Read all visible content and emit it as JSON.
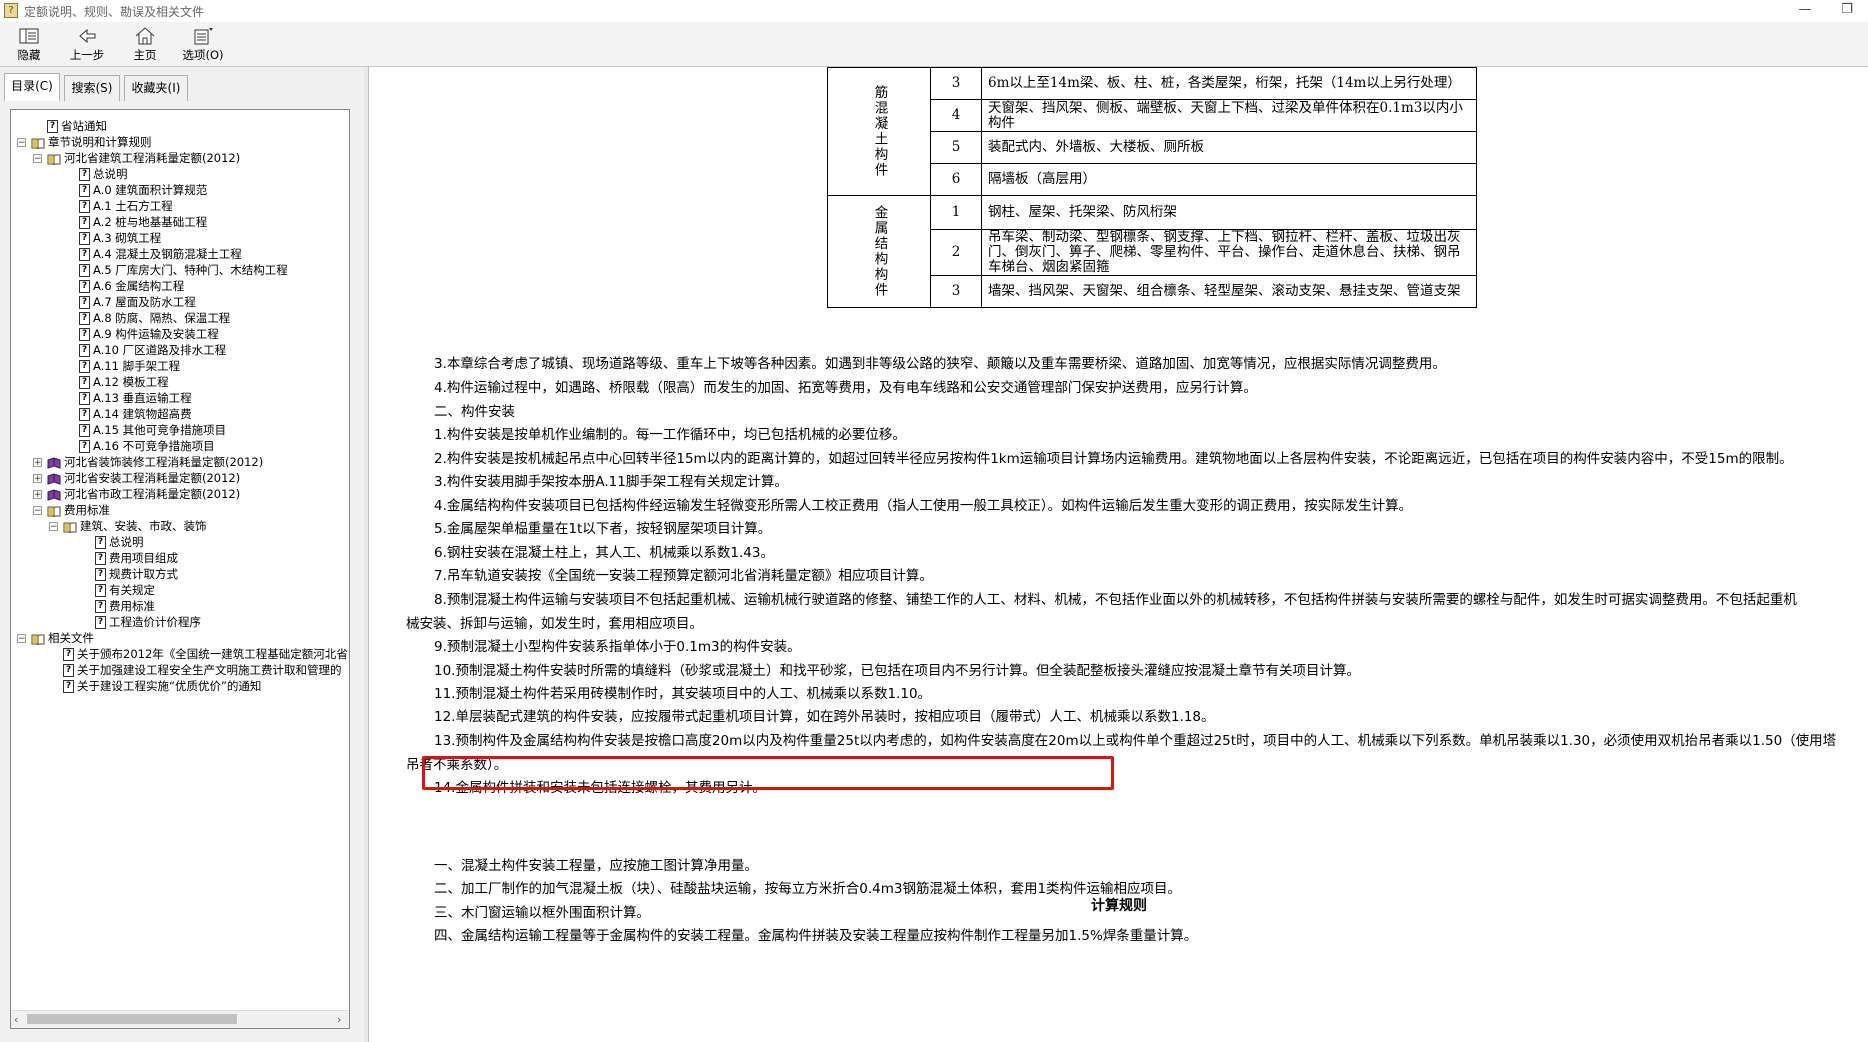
{
  "window": {
    "title": "定额说明、规则、勘误及相关文件",
    "min_glyph": "—",
    "max_glyph": "❐"
  },
  "toolbar": {
    "hide": "隐藏",
    "back": "上一步",
    "home": "主页",
    "options": "选项(O)"
  },
  "left_tabs": [
    "目录(C)",
    "搜索(S)",
    "收藏夹(I)"
  ],
  "tree": [
    {
      "label": "省站通知",
      "icon": "doc",
      "level": 1
    },
    {
      "label": "章节说明和计算规则",
      "icon": "book",
      "level": 0,
      "exp": "−"
    },
    {
      "label": "河北省建筑工程消耗量定额(2012)",
      "icon": "book",
      "level": 1,
      "exp": "−"
    },
    {
      "label": "总说明",
      "icon": "doc",
      "level": 3
    },
    {
      "label": "A.0 建筑面积计算规范",
      "icon": "doc",
      "level": 3
    },
    {
      "label": "A.1 土石方工程",
      "icon": "doc",
      "level": 3
    },
    {
      "label": "A.2 桩与地基基础工程",
      "icon": "doc",
      "level": 3
    },
    {
      "label": "A.3 砌筑工程",
      "icon": "doc",
      "level": 3
    },
    {
      "label": "A.4 混凝土及钢筋混凝土工程",
      "icon": "doc",
      "level": 3
    },
    {
      "label": "A.5 厂库房大门、特种门、木结构工程",
      "icon": "doc",
      "level": 3
    },
    {
      "label": "A.6 金属结构工程",
      "icon": "doc",
      "level": 3
    },
    {
      "label": "A.7 屋面及防水工程",
      "icon": "doc",
      "level": 3
    },
    {
      "label": "A.8 防腐、隔热、保温工程",
      "icon": "doc",
      "level": 3
    },
    {
      "label": "A.9 构件运输及安装工程",
      "icon": "doc",
      "level": 3
    },
    {
      "label": "A.10 厂区道路及排水工程",
      "icon": "doc",
      "level": 3
    },
    {
      "label": "A.11 脚手架工程",
      "icon": "doc",
      "level": 3
    },
    {
      "label": "A.12 模板工程",
      "icon": "doc",
      "level": 3
    },
    {
      "label": "A.13 垂直运输工程",
      "icon": "doc",
      "level": 3
    },
    {
      "label": "A.14 建筑物超高费",
      "icon": "doc",
      "level": 3
    },
    {
      "label": "A.15 其他可竞争措施项目",
      "icon": "doc",
      "level": 3
    },
    {
      "label": "A.16 不可竞争措施项目",
      "icon": "doc",
      "level": 3
    },
    {
      "label": "河北省装饰装修工程消耗量定额(2012)",
      "icon": "bookc",
      "level": 1,
      "exp": "+"
    },
    {
      "label": "河北省安装工程消耗量定额(2012)",
      "icon": "bookc",
      "level": 1,
      "exp": "+"
    },
    {
      "label": "河北省市政工程消耗量定额(2012)",
      "icon": "bookc",
      "level": 1,
      "exp": "+"
    },
    {
      "label": "费用标准",
      "icon": "book",
      "level": 1,
      "exp": "−"
    },
    {
      "label": "建筑、安装、市政、装饰",
      "icon": "book",
      "level": 2,
      "exp": "−"
    },
    {
      "label": "总说明",
      "icon": "doc",
      "level": 4
    },
    {
      "label": "费用项目组成",
      "icon": "doc",
      "level": 4
    },
    {
      "label": "规费计取方式",
      "icon": "doc",
      "level": 4
    },
    {
      "label": "有关规定",
      "icon": "doc",
      "level": 4
    },
    {
      "label": "费用标准",
      "icon": "doc",
      "level": 4
    },
    {
      "label": "工程造价计价程序",
      "icon": "doc",
      "level": 4
    },
    {
      "label": "相关文件",
      "icon": "book",
      "level": 0,
      "exp": "−"
    },
    {
      "label": "关于颁布2012年《全国统一建筑工程基础定额河北省",
      "icon": "doc",
      "level": 2
    },
    {
      "label": "关于加强建设工程安全生产文明施工费计取和管理的",
      "icon": "doc",
      "level": 2
    },
    {
      "label": "关于建设工程实施“优质优价”的通知",
      "icon": "doc",
      "level": 2
    }
  ],
  "table": {
    "groups": [
      {
        "category": "筋混凝土构件",
        "rows": [
          {
            "num": "3",
            "desc": "6m以上至14m梁、板、柱、桩，各类屋架，桁架，托架（14m以上另行处理）"
          },
          {
            "num": "4",
            "desc": "天窗架、挡风架、侧板、端壁板、天窗上下档、过梁及单件体积在0.1m3以内小构件"
          },
          {
            "num": "5",
            "desc": "装配式内、外墙板、大楼板、厕所板"
          },
          {
            "num": "6",
            "desc": "隔墙板（高层用）"
          }
        ]
      },
      {
        "category": "金属结构构件",
        "rows": [
          {
            "num": "1",
            "desc": "钢柱、屋架、托架梁、防风桁架"
          },
          {
            "num": "2",
            "desc": "吊车梁、制动梁、型钢檩条、钢支撑、上下档、钢拉杆、栏杆、盖板、垃圾出灰门、倒灰门、箅子、爬梯、零星构件、平台、操作台、走道休息台、扶梯、钢吊车梯台、烟囱紧固箍"
          },
          {
            "num": "3",
            "desc": "墙架、挡风架、天窗架、组合檩条、轻型屋架、滚动支架、悬挂支架、管道支架"
          }
        ]
      }
    ]
  },
  "paragraphs": [
    "3.本章综合考虑了城镇、现场道路等级、重车上下坡等各种因素。如遇到非等级公路的狭窄、颠簸以及重车需要桥梁、道路加固、加宽等情况，应根据实际情况调整费用。",
    "4.构件运输过程中，如遇路、桥限载（限高）而发生的加固、拓宽等费用，及有电车线路和公安交通管理部门保安护送费用，应另行计算。",
    "二、构件安装",
    "1.构件安装是按单机作业编制的。每一工作循环中，均已包括机械的必要位移。",
    "2.构件安装是按机械起吊点中心回转半径15m以内的距离计算的，如超过回转半径应另按构件1km运输项目计算场内运输费用。建筑物地面以上各层构件安装，不论距离远近，已包括在项目的构件安装内容中，不受15m的限制。",
    "3.构件安装用脚手架按本册A.11脚手架工程有关规定计算。",
    "4.金属结构构件安装项目已包括构件经运输发生轻微变形所需人工校正费用（指人工使用一般工具校正）。如构件运输后发生重大变形的调正费用，按实际发生计算。",
    "5.金属屋架单榀重量在1t以下者，按轻钢屋架项目计算。",
    "6.钢柱安装在混凝土柱上，其人工、机械乘以系数1.43。",
    "7.吊车轨道安装按《全国统一安装工程预算定额河北省消耗量定额》相应项目计算。",
    "8.预制混凝土构件运输与安装项目不包括起重机械、运输机械行驶道路的修整、铺垫工作的人工、材料、机械，不包括作业面以外的机械转移，不包括构件拼装与安装所需要的螺栓与配件，如发生时可据实调整费用。不包括起重机",
    "械安装、拆卸与运输，如发生时，套用相应项目。",
    "9.预制混凝土小型构件安装系指单体小于0.1m3的构件安装。",
    "10.预制混凝土构件安装时所需的填缝料（砂浆或混凝土）和找平砂浆，已包括在项目内不另行计算。但全装配整板接头灌缝应按混凝土章节有关项目计算。",
    "11.预制混凝土构件若采用砖模制作时，其安装项目中的人工、机械乘以系数1.10。",
    "12.单层装配式建筑的构件安装，应按履带式起重机项目计算，如在跨外吊装时，按相应项目（履带式）人工、机械乘以系数1.18。",
    "13.预制构件及金属结构构件安装是按檐口高度20m以内及构件重量25t以内考虑的，如构件安装高度在20m以上或构件单个重超过25t时，项目中的人工、机械乘以下列系数。单机吊装乘以1.30，必须使用双机抬吊者乘以1.50（使用塔",
    "吊者不乘系数）。",
    "14.金属构件拼装和安装未包括连接螺栓，其费用另计。"
  ],
  "rules_heading": "计算规则",
  "rules": [
    "一、混凝土构件安装工程量，应按施工图计算净用量。",
    "二、加工厂制作的加气混凝土板（块）、硅酸盐块运输，按每立方米折合0.4m3钢筋混凝土体积，套用1类构件运输相应项目。",
    "三、木门窗运输以框外围面积计算。",
    "四、金属结构运输工程量等于金属构件的安装工程量。金属构件拼装及安装工程量应按构件制作工程量另加1.5%焊条重量计算。"
  ],
  "accent_colors": {
    "highlight": "#e01010"
  }
}
